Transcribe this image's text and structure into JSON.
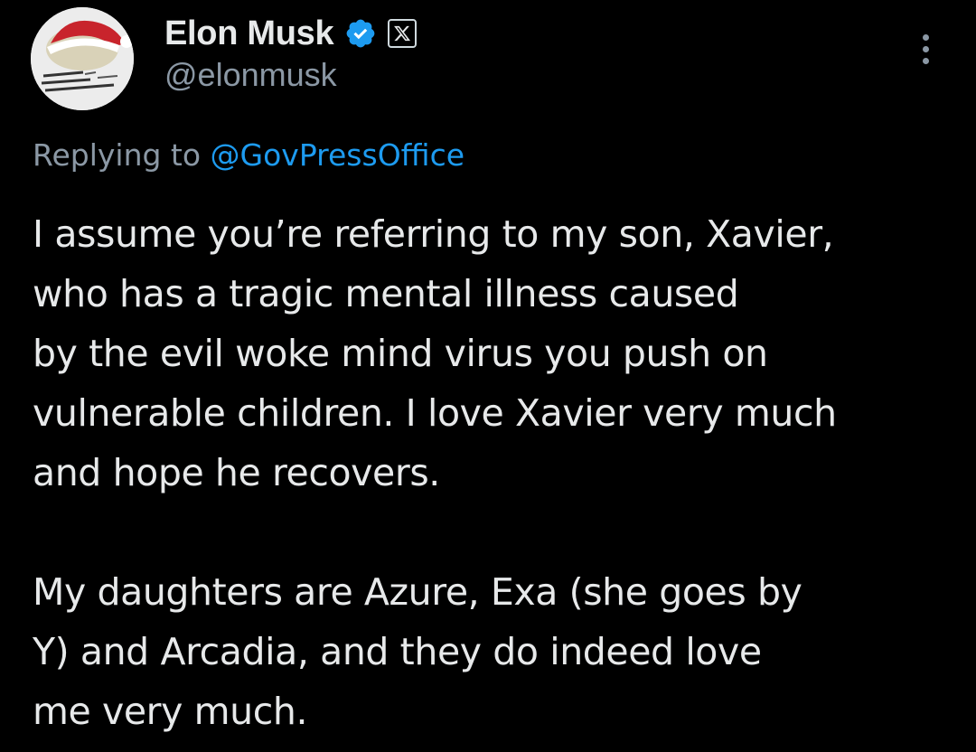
{
  "author": {
    "display_name": "Elon Musk",
    "handle": "@elonmusk",
    "verified_icon": "verified-badge-icon",
    "affiliation_icon": "x-logo-icon",
    "verified_color": "#1d9bf0"
  },
  "reply": {
    "prefix": "Replying to ",
    "mention": "@GovPressOffice",
    "mention_color": "#1d9bf0"
  },
  "tweet": {
    "paragraph1_lines": [
      "I assume you’re referring to my son, Xavier,",
      "who has a tragic mental illness caused",
      "by the evil woke mind virus you push on",
      "vulnerable children. I love Xavier very much",
      "and hope he recovers."
    ],
    "paragraph2_lines": [
      "My daughters are Azure, Exa (she goes by",
      "Y) and Arcadia, and they do indeed love",
      "me very much."
    ]
  },
  "menu": {
    "more_icon": "more-dots-icon"
  },
  "theme": {
    "background": "#000000",
    "text": "#e7e9ea",
    "muted": "#8b98a5"
  }
}
